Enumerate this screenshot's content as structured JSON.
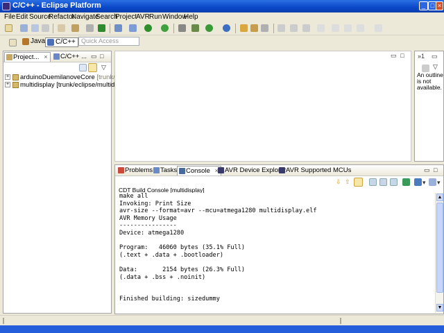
{
  "window": {
    "title": "C/C++ - Eclipse Platform"
  },
  "menu": [
    "File",
    "Edit",
    "Source",
    "Refactor",
    "Navigate",
    "Search",
    "Project",
    "AVR",
    "Run",
    "Window",
    "Help"
  ],
  "perspectives": {
    "java": "Java",
    "cpp": "C/C++"
  },
  "quick_access": {
    "placeholder": "Quick Access"
  },
  "left_panel": {
    "tabs": [
      {
        "label": "Project..."
      },
      {
        "label": "C/C++ ..."
      }
    ],
    "tree": [
      {
        "name": "arduinoDuemilanoveCore",
        "decoration": "[trunk/eclipse/"
      },
      {
        "name": "multidisplay",
        "decoration": "[trunk/eclipse/multidisplay]"
      }
    ]
  },
  "outline": {
    "message": "An outline is not available."
  },
  "bottom_panel": {
    "tabs": [
      {
        "label": "Problems"
      },
      {
        "label": "Tasks"
      },
      {
        "label": "Console"
      },
      {
        "label": "AVR Device Explorer"
      },
      {
        "label": "AVR Supported MCUs"
      }
    ],
    "console_header": "CDT Build Console [multidisplay]",
    "console_lines": [
      "make all",
      "Invoking: Print Size",
      "avr-size --format=avr --mcu=atmega1280 multidisplay.elf",
      "AVR Memory Usage",
      "----------------",
      "Device: atmega1280",
      "",
      "Program:   46060 bytes (35.1% Full)",
      "(.text + .data + .bootloader)",
      "",
      "Data:       2154 bytes (26.3% Full)",
      "(.data + .bss + .noinit)",
      "",
      "",
      "Finished building: sizedummy"
    ]
  },
  "colors": {
    "titlebar": "#0a47c8",
    "chrome": "#ece9d8",
    "selection": "#316ac5"
  }
}
